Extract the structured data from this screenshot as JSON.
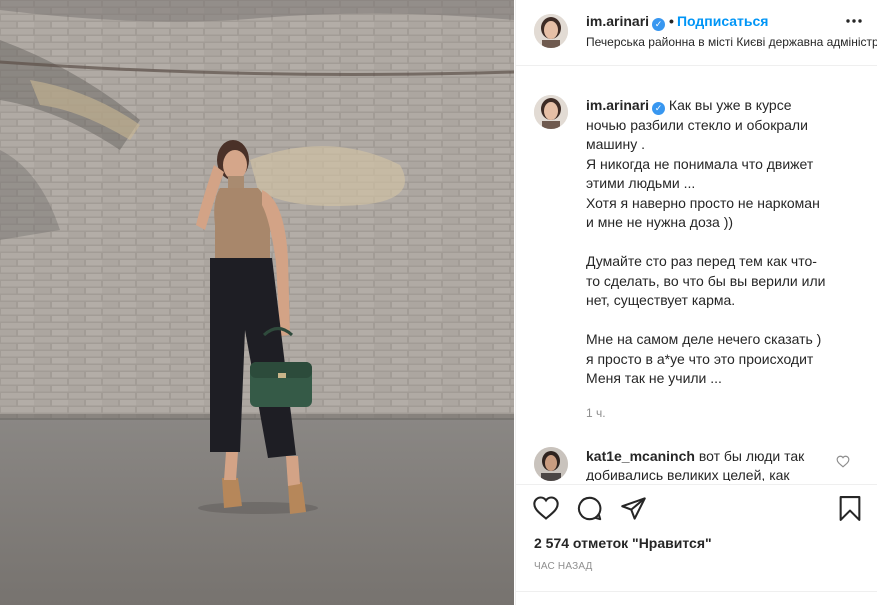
{
  "post": {
    "username": "im.arinari",
    "verified_mark": "✓",
    "separator": "•",
    "follow_label": "Подписаться",
    "location": "Печерська районна в місті Києві державна адміністрація",
    "more_label": "•••"
  },
  "caption": {
    "username": "im.arinari",
    "lines": [
      "Как вы уже в курсе",
      "ночью разбили стекло и обокрали",
      "машину .",
      "Я никогда не понимала что движет",
      "этими людьми ...",
      "Хотя я наверно просто не наркоман",
      "и мне не нужна доза ))",
      "",
      "Думайте сто раз перед тем как что-",
      "то сделать, во что бы вы верили или",
      "нет, существует карма.",
      "",
      "Мне на самом деле нечего сказать )",
      "я просто в а*уе что это происходит",
      "Меня так не учили ..."
    ],
    "time": "1 ч."
  },
  "comment": {
    "username": "kat1e_mcaninch",
    "text": "вот бы люди так добивались великих целей, как"
  },
  "actions": {
    "like_icon": "heart-icon",
    "comment_icon": "comment-icon",
    "share_icon": "share-icon",
    "save_icon": "bookmark-icon",
    "likes_text": "2 574 отметок \"Нравится\"",
    "posted_ago": "ЧАС НАЗАД"
  },
  "colors": {
    "accent": "#0095f6",
    "verified": "#3897f0",
    "text": "#262626",
    "muted": "#8e8e8e",
    "border": "#efefef"
  }
}
